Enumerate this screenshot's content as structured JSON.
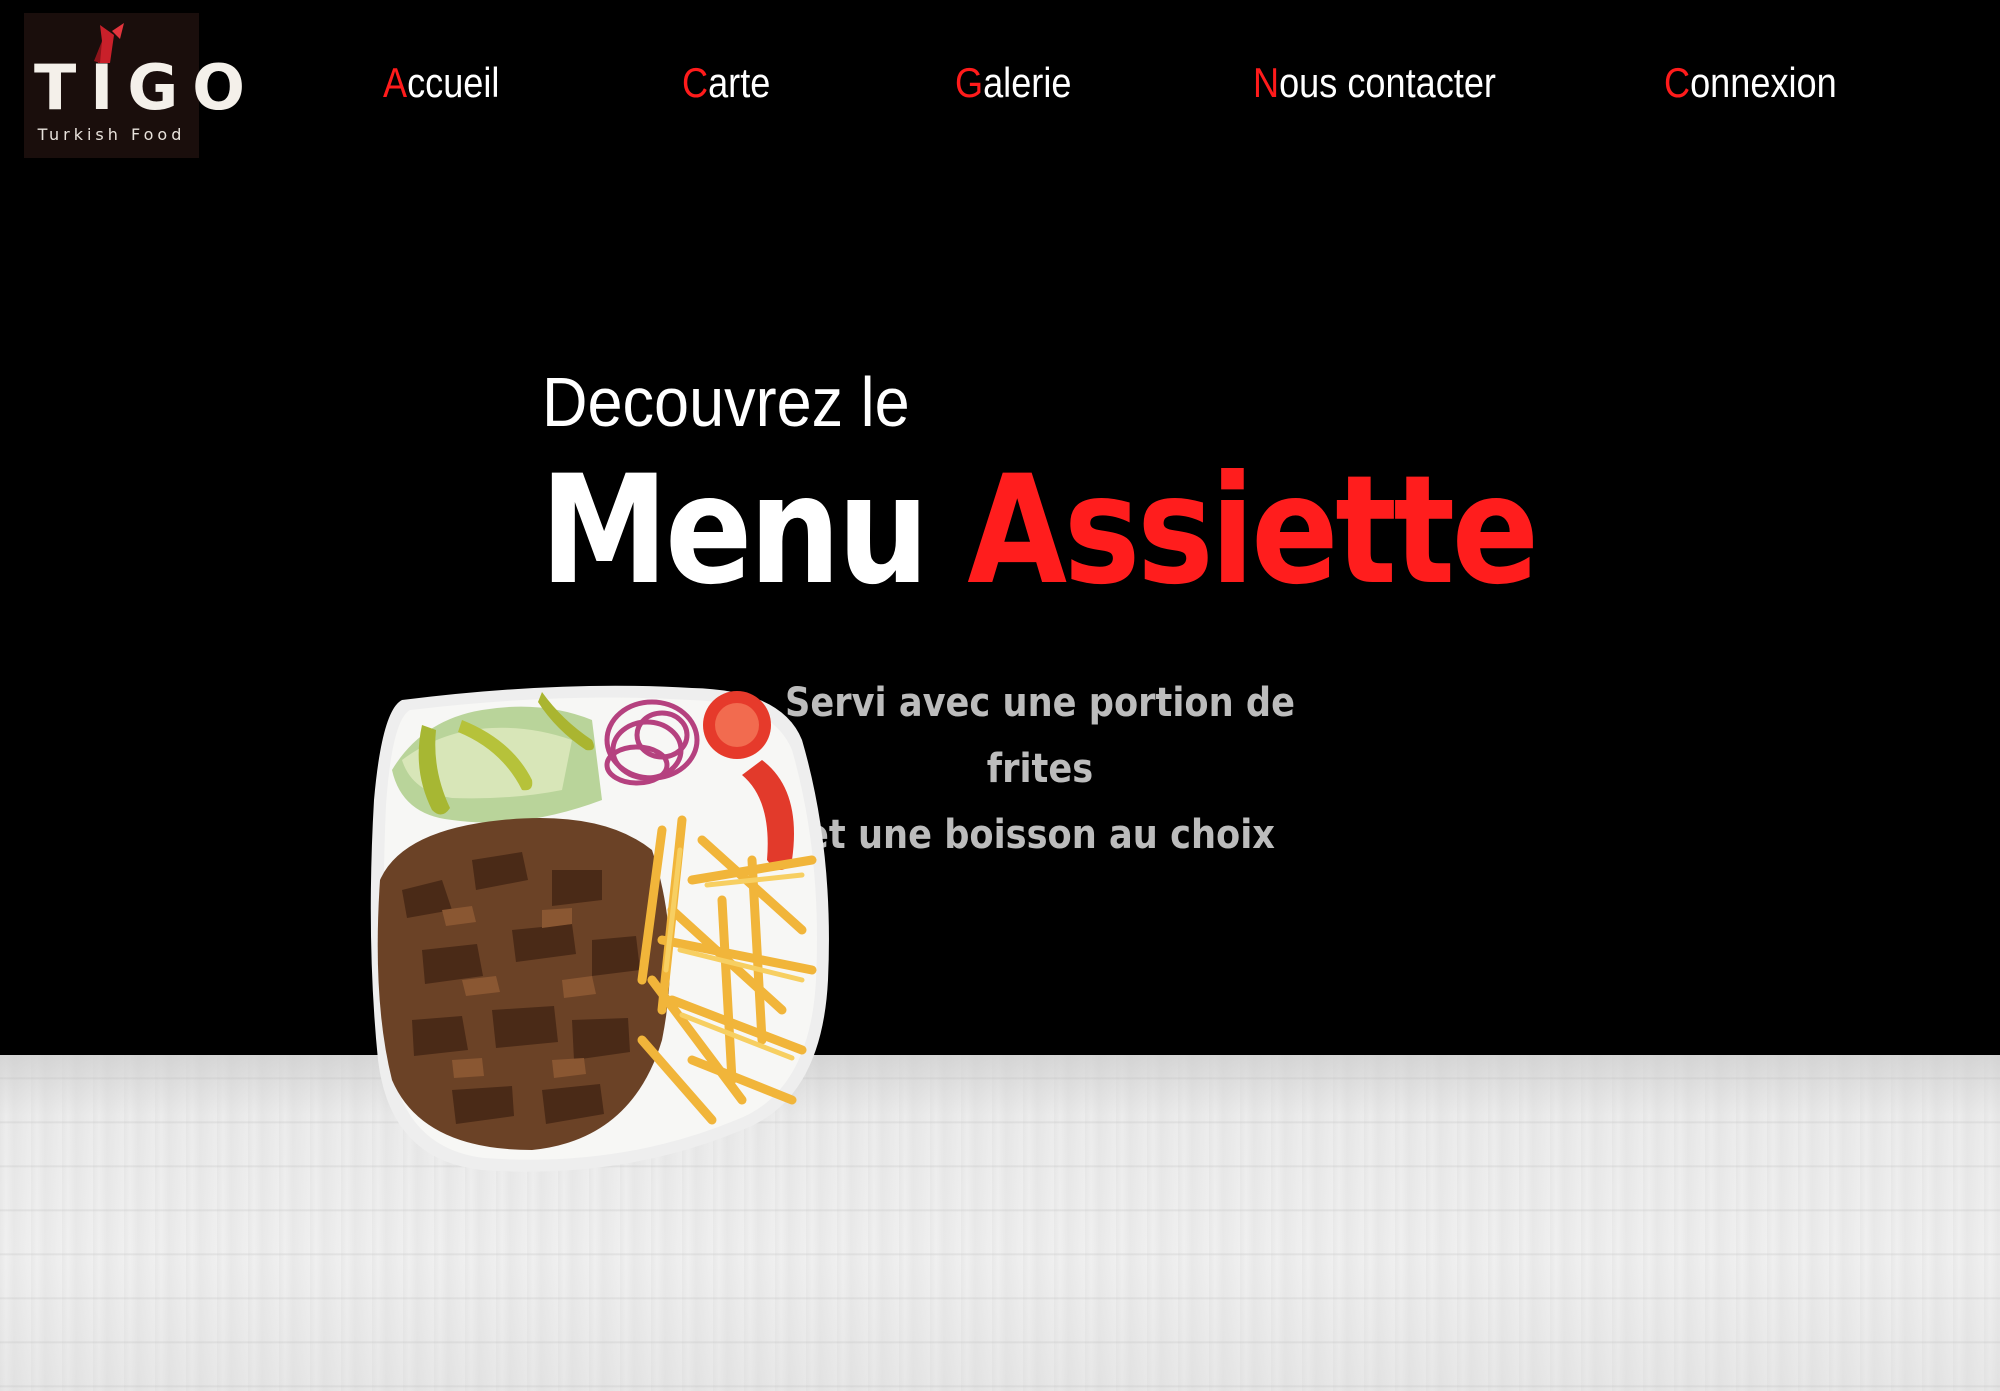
{
  "brand": {
    "name": "TIGO",
    "tagline": "Turkish Food"
  },
  "nav": {
    "items": [
      {
        "first": "A",
        "rest": "ccueil"
      },
      {
        "first": "C",
        "rest": "arte"
      },
      {
        "first": "G",
        "rest": "alerie"
      },
      {
        "first": "N",
        "rest": "ous contacter"
      },
      {
        "first": "C",
        "rest": "onnexion"
      }
    ]
  },
  "hero": {
    "kicker": "Decouvrez le",
    "title_white": "Menu",
    "title_red": "Assiette",
    "desc_line1": "Servi avec une portion de frites",
    "desc_line2": "et une boisson au choix"
  },
  "colors": {
    "accent": "#ff1d1d",
    "background": "#000000",
    "text": "#ffffff",
    "muted": "#bcbcbc"
  }
}
